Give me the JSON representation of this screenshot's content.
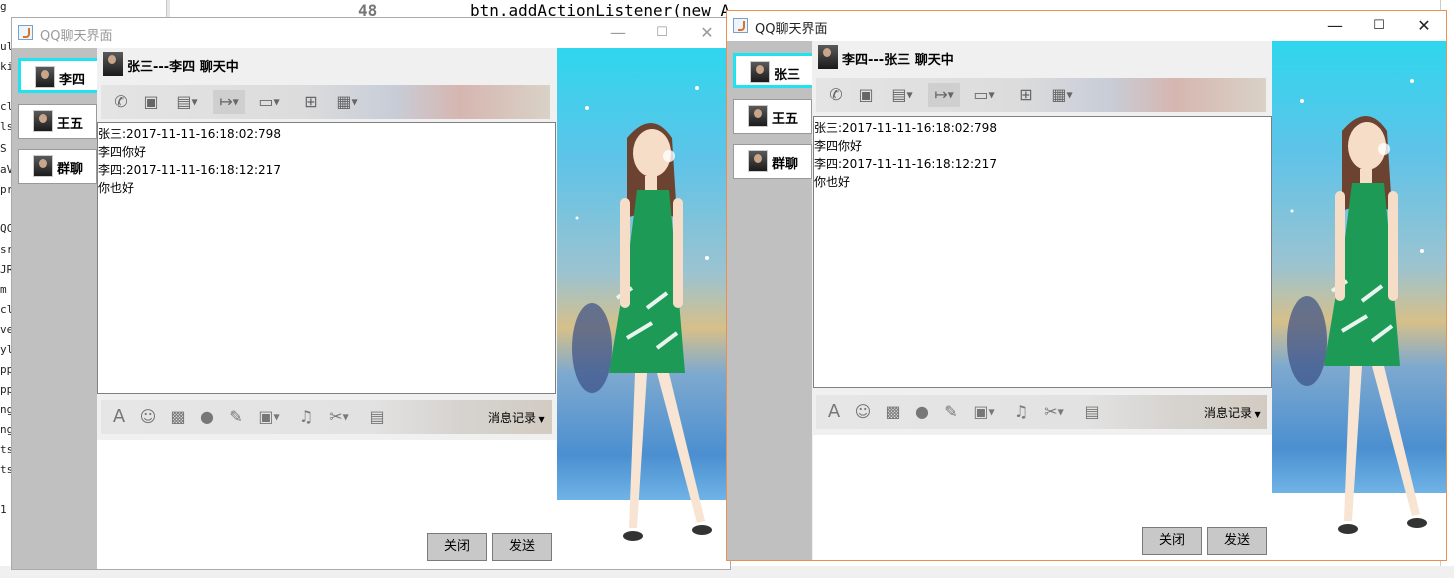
{
  "ide": {
    "line_number": "48",
    "code_line": "btn.addActionListener(new ActionListener(",
    "left_fragments": [
      "g",
      "ul",
      "ki",
      "cl",
      "ls",
      "S",
      "aV",
      "pr",
      "",
      "QC",
      "src",
      "JR",
      "m",
      "cle",
      "ve",
      "yle",
      "pp",
      "pp",
      "ng",
      "ng",
      "ts",
      "ts",
      "",
      "1"
    ]
  },
  "windows": [
    {
      "title": "QQ聊天界面",
      "contacts": [
        {
          "name": "李四",
          "selected": true
        },
        {
          "name": "王五",
          "selected": false
        },
        {
          "name": "群聊",
          "selected": false
        }
      ],
      "chat_title": "张三---李四 聊天中",
      "messages": [
        "张三:2017-11-11-16:18:02:798",
        "李四你好",
        "李四:2017-11-11-16:18:12:217",
        "你也好"
      ],
      "history_label": "消息记录",
      "close_label": "关闭",
      "send_label": "发送"
    },
    {
      "title": "QQ聊天界面",
      "contacts": [
        {
          "name": "张三",
          "selected": true
        },
        {
          "name": "王五",
          "selected": false
        },
        {
          "name": "群聊",
          "selected": false
        }
      ],
      "chat_title": "李四---张三 聊天中",
      "messages": [
        "张三:2017-11-11-16:18:02:798",
        "李四你好",
        "李四:2017-11-11-16:18:12:217",
        "你也好"
      ],
      "history_label": "消息记录",
      "close_label": "关闭",
      "send_label": "发送"
    }
  ],
  "top_toolbar_icons": [
    "phone-icon",
    "video-icon",
    "remote-desktop-icon",
    "file-transfer-icon",
    "screen-share-icon",
    "add-comment-icon",
    "apps-grid-icon"
  ],
  "bottom_toolbar_icons": [
    "font-icon",
    "emoji-icon",
    "shake-icon",
    "microphone-icon",
    "pen-icon",
    "image-icon",
    "music-icon",
    "scissors-icon",
    "red-packet-icon"
  ],
  "window_controls": {
    "minimize": "—",
    "maximize": "☐",
    "close": "✕"
  },
  "colors": {
    "selected_contact_border": "#21e3f0",
    "active_window_border": "#e89050"
  }
}
